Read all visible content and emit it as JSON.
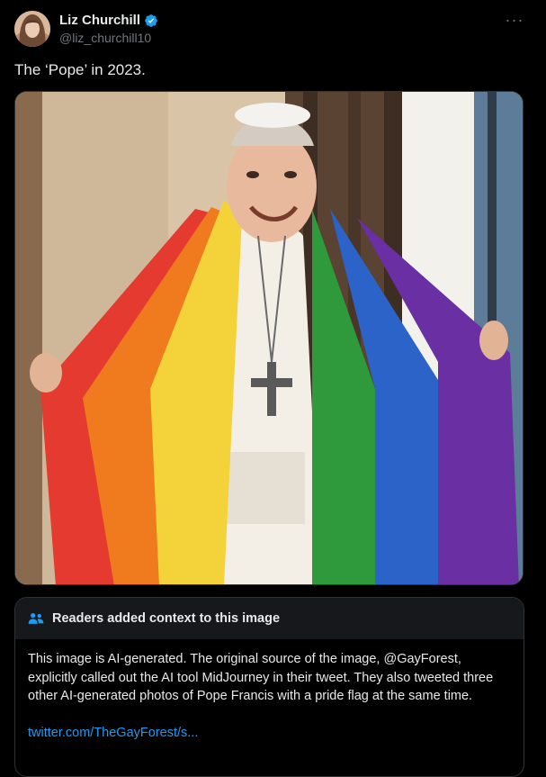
{
  "tweet": {
    "author_name": "Liz Churchill",
    "author_handle": "@liz_churchill10",
    "more_label": "···",
    "text": "The ‘Pope’ in 2023.",
    "image_alt": "Photo of the Pope smiling while draped in a rainbow pride flag"
  },
  "community_note": {
    "title": "Readers added context to this image",
    "body": "This image is AI-generated. The original source of the image, @GayForest, explicitly called out the AI tool MidJourney in their tweet. They also tweeted three other AI-generated photos of Pope Francis with a pride flag at the same time.",
    "link_text": "twitter.com/TheGayForest/s..."
  },
  "colors": {
    "background": "#000000",
    "text": "#e7e9ea",
    "secondary_text": "#71767b",
    "link": "#1d9bf0",
    "verified_badge": "#1d9bf0",
    "border": "#2f3336",
    "note_header_bg": "#16181c"
  },
  "icons": {
    "verified": "verified-badge-icon",
    "more": "more-dots-icon",
    "note": "people-icon"
  }
}
